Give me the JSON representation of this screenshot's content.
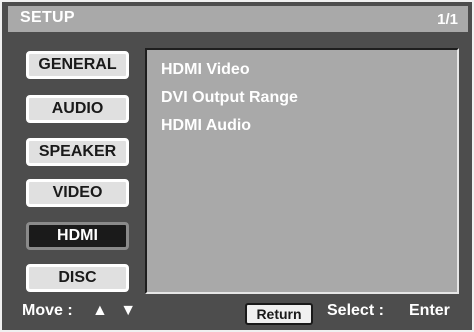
{
  "header": {
    "title": "SETUP",
    "page_indicator": "1/1"
  },
  "tabs": [
    {
      "label": "GENERAL",
      "selected": false
    },
    {
      "label": "AUDIO",
      "selected": false
    },
    {
      "label": "SPEAKER",
      "selected": false
    },
    {
      "label": "VIDEO",
      "selected": false
    },
    {
      "label": "HDMI",
      "selected": true
    },
    {
      "label": "DISC",
      "selected": false
    }
  ],
  "menu": {
    "items": [
      {
        "label": "HDMI Video"
      },
      {
        "label": "DVI Output Range"
      },
      {
        "label": "HDMI Audio"
      }
    ]
  },
  "footer": {
    "move_label": "Move :",
    "move_arrows": "▲ ▼",
    "return_label": "Return",
    "select_label": "Select :",
    "select_value": "Enter"
  },
  "colors": {
    "background": "#4d4d4d",
    "title_bar": "#a9a9a9",
    "panel": "#a9a9a9",
    "selected_tab": "#1a1a1a",
    "tab": "#e0e0e0",
    "text": "#ffffff"
  }
}
